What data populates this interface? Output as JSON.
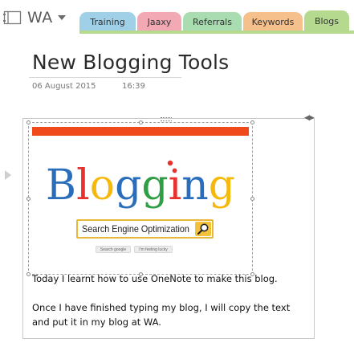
{
  "notebook": {
    "name": "WA",
    "icon": "notebook-icon"
  },
  "tabs": [
    {
      "label": "Training",
      "color": "#9fd0e8"
    },
    {
      "label": "Jaaxy",
      "color": "#f3a9b4"
    },
    {
      "label": "Referrals",
      "color": "#a9dcb0"
    },
    {
      "label": "Keywords",
      "color": "#f6c08d"
    },
    {
      "label": "Blogs",
      "color": "#b5d98f",
      "active": true
    }
  ],
  "page": {
    "title": "New Blogging Tools",
    "date": "06 August 2015",
    "time": "16:39"
  },
  "image": {
    "logo_text": "Blogging",
    "search_box_text": "Search Engine Optimization",
    "button_left": "Search google",
    "button_right": "I'm feeling lucky",
    "logo_colors": [
      "#2a6ebb",
      "#e8322d",
      "#f6b90b",
      "#2a6ebb",
      "#2f9e44",
      "#e8322d",
      "#2a6ebb",
      "#f6b90b"
    ]
  },
  "note": {
    "line1": "Today I learnt how to use OneNote to make this blog.",
    "line2": "Once I have finished typing my blog, I will copy the text",
    "line3": "and put it in my blog at WA."
  }
}
